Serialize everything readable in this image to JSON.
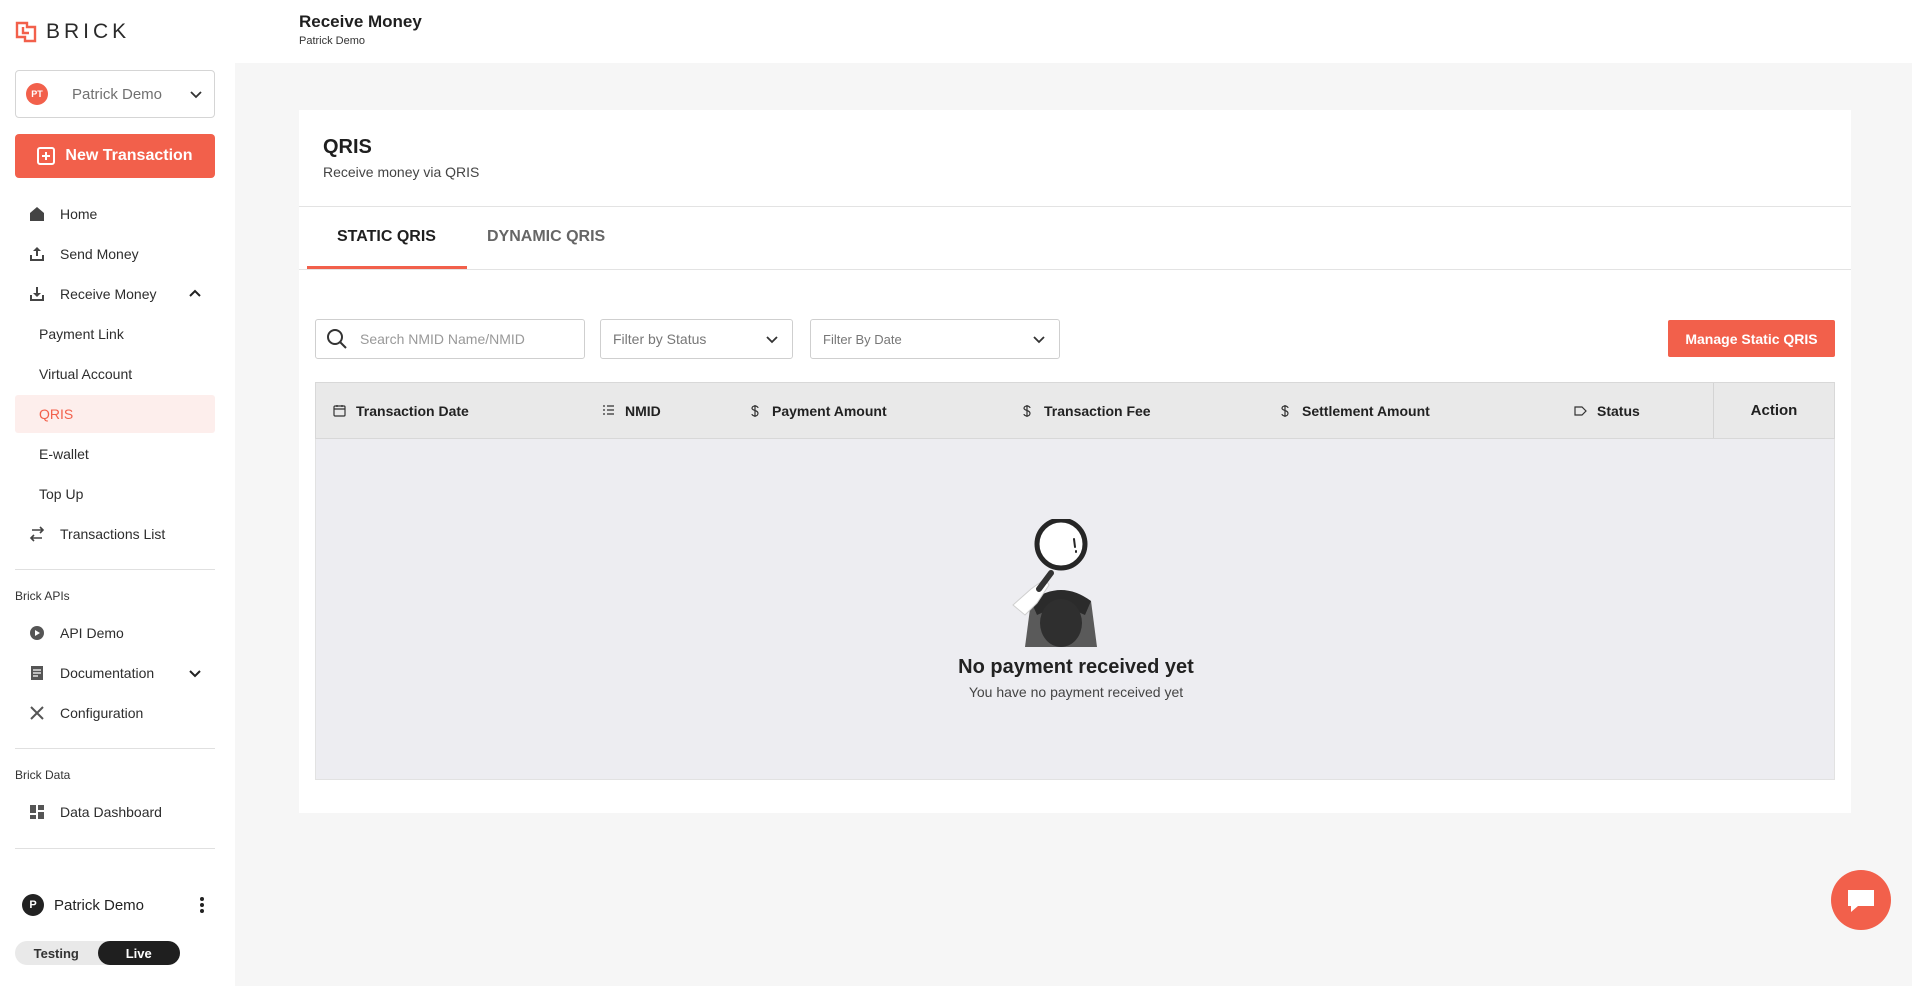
{
  "brand": {
    "name": "BRICK",
    "accent": "#f2604b"
  },
  "account": {
    "initials": "PT",
    "name": "Patrick Demo"
  },
  "new_transaction_label": "New Transaction",
  "sidebar": {
    "items": [
      {
        "label": "Home",
        "icon": "home-icon"
      },
      {
        "label": "Send Money",
        "icon": "upload-icon"
      },
      {
        "label": "Receive Money",
        "icon": "download-icon"
      },
      {
        "label": "Payment Link"
      },
      {
        "label": "Virtual Account"
      },
      {
        "label": "QRIS"
      },
      {
        "label": "E-wallet"
      },
      {
        "label": "Top Up"
      },
      {
        "label": "Transactions List",
        "icon": "transfer-arrows-icon"
      }
    ],
    "apis_title": "Brick APIs",
    "apis_items": [
      {
        "label": "API Demo",
        "icon": "play-icon"
      },
      {
        "label": "Documentation",
        "icon": "document-icon"
      },
      {
        "label": "Configuration",
        "icon": "tools-icon"
      }
    ],
    "data_title": "Brick Data",
    "data_items": [
      {
        "label": "Data Dashboard",
        "icon": "dashboard-icon"
      }
    ]
  },
  "user": {
    "initial": "P",
    "name": "Patrick Demo"
  },
  "env": {
    "testing": "Testing",
    "live": "Live",
    "selected": "Live"
  },
  "header": {
    "title": "Receive Money",
    "subtitle": "Patrick Demo"
  },
  "card": {
    "title": "QRIS",
    "subtitle": "Receive money via QRIS",
    "tabs": [
      {
        "label": "STATIC QRIS",
        "active": true
      },
      {
        "label": "DYNAMIC QRIS",
        "active": false
      }
    ]
  },
  "filters": {
    "search_placeholder": "Search NMID Name/NMID",
    "status_label": "Filter by Status",
    "date_label": "Filter By Date",
    "manage_button": "Manage Static QRIS"
  },
  "table": {
    "columns": [
      {
        "label": "Transaction Date",
        "icon": "calendar-icon"
      },
      {
        "label": "NMID",
        "icon": "list-icon"
      },
      {
        "label": "Payment Amount",
        "icon": "dollar-icon"
      },
      {
        "label": "Transaction Fee",
        "icon": "dollar-icon"
      },
      {
        "label": "Settlement Amount",
        "icon": "dollar-icon"
      },
      {
        "label": "Status",
        "icon": "tag-icon"
      }
    ],
    "action_label": "Action",
    "empty_title": "No payment received yet",
    "empty_subtitle": "You have no payment received yet"
  }
}
